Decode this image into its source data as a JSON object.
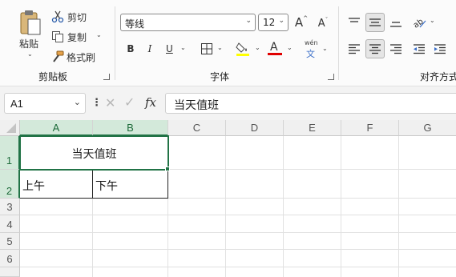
{
  "ribbon": {
    "clipboard": {
      "paste_label": "粘贴",
      "cut_label": "剪切",
      "copy_label": "复制",
      "format_painter_label": "格式刷",
      "group_label": "剪贴板"
    },
    "font": {
      "font_name": "等线",
      "font_size": "12",
      "grow_label": "A",
      "shrink_label": "A",
      "bold": "B",
      "italic": "I",
      "underline": "U",
      "font_color_letter": "A",
      "wen": "wén",
      "wen_char": "文",
      "group_label": "字体",
      "highlight_color": "#ffff00",
      "font_color": "#e00000"
    },
    "alignment": {
      "group_label": "对齐方式"
    }
  },
  "formula_bar": {
    "name_box": "A1",
    "fx_label": "fx",
    "content": "当天值班"
  },
  "sheet": {
    "columns": [
      "A",
      "B",
      "C",
      "D",
      "E",
      "F",
      "G"
    ],
    "rows": [
      "1",
      "2",
      "3",
      "4",
      "5",
      "6"
    ],
    "cells": {
      "a1_merged": "当天值班",
      "a2": "上午",
      "b2": "下午"
    }
  },
  "colors": {
    "accent": "#217346",
    "header_active_bg": "#d3e9da"
  }
}
